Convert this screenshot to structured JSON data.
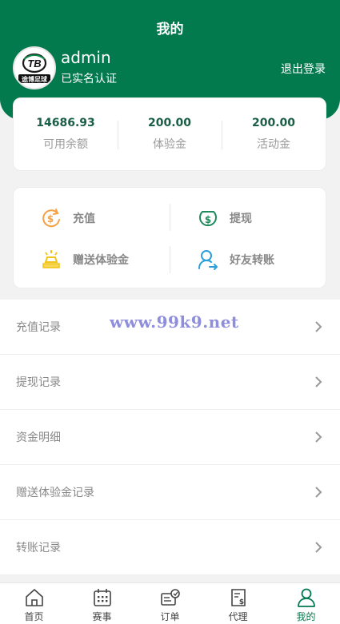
{
  "header": {
    "title": "我的",
    "username": "admin",
    "verify_status": "已实名认证",
    "logout_label": "退出登录",
    "logo_text": "TB",
    "logo_subtext": "途博足球"
  },
  "stats": [
    {
      "value": "14686.93",
      "label": "可用余额"
    },
    {
      "value": "200.00",
      "label": "体验金"
    },
    {
      "value": "200.00",
      "label": "活动金"
    }
  ],
  "actions": [
    {
      "label": "充值",
      "icon": "recharge-icon"
    },
    {
      "label": "提现",
      "icon": "withdraw-icon"
    },
    {
      "label": "赠送体验金",
      "icon": "gold-bar-icon"
    },
    {
      "label": "好友转账",
      "icon": "transfer-user-icon"
    }
  ],
  "menu": [
    {
      "label": "充值记录"
    },
    {
      "label": "提现记录"
    },
    {
      "label": "资金明细"
    },
    {
      "label": "赠送体验金记录"
    },
    {
      "label": "转账记录"
    }
  ],
  "watermark": "www.99k9.net",
  "tabbar": [
    {
      "label": "首页",
      "icon": "home-icon"
    },
    {
      "label": "赛事",
      "icon": "calendar-icon"
    },
    {
      "label": "订单",
      "icon": "order-icon"
    },
    {
      "label": "代理",
      "icon": "agent-icon"
    },
    {
      "label": "我的",
      "icon": "user-icon",
      "active": true
    }
  ],
  "colors": {
    "brand": "#027a4e",
    "stat_value": "#1b5e46",
    "watermark": "#8e8edc"
  }
}
